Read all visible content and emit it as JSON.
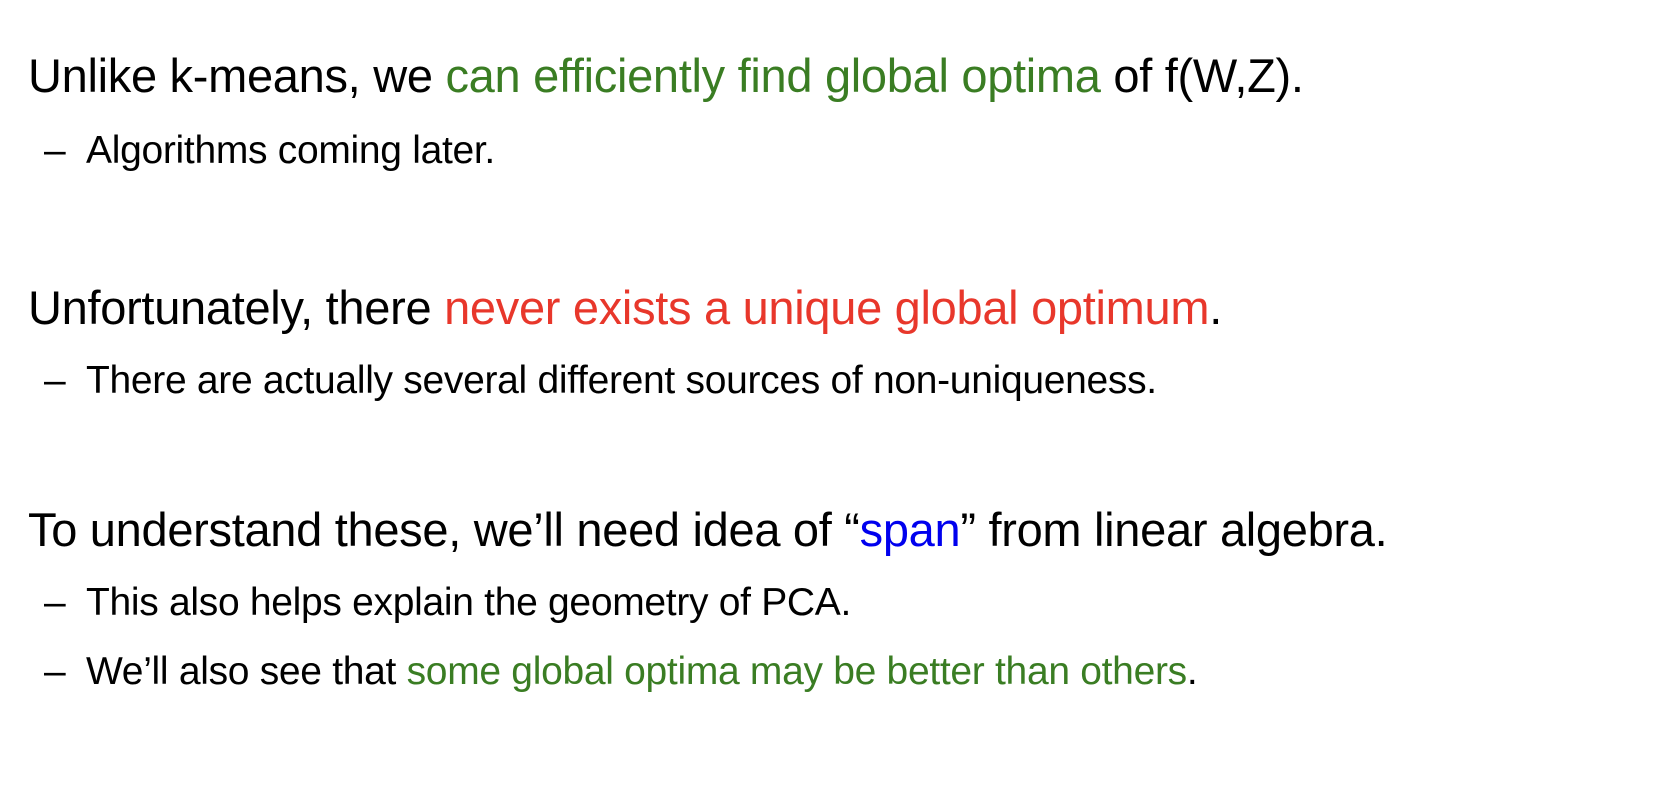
{
  "colors": {
    "green": "#3a7d23",
    "red": "#e8372b",
    "blue": "#0000ee",
    "text": "#000000",
    "background": "#ffffff"
  },
  "bullets": [
    {
      "main": {
        "pre": "Unlike k-means, we ",
        "highlight": "can efficiently find global optima",
        "post": " of f(W,Z)."
      },
      "subs": [
        {
          "dash": "–",
          "text": "Algorithms coming later."
        }
      ]
    },
    {
      "main": {
        "pre": "Unfortunately, there ",
        "highlight": "never exists a unique global optimum",
        "post": "."
      },
      "subs": [
        {
          "dash": "–",
          "text": "There are actually several different sources of non-uniqueness."
        }
      ]
    },
    {
      "main": {
        "pre": "To understand these, we’ll need idea of “",
        "highlight": "span",
        "post": "” from linear algebra."
      },
      "subs": [
        {
          "dash": "–",
          "text": "This also helps explain the geometry of PCA."
        },
        {
          "dash": "–",
          "pre": "We’ll also see that ",
          "highlight": "some global optima may be better than others",
          "post": "."
        }
      ]
    }
  ]
}
